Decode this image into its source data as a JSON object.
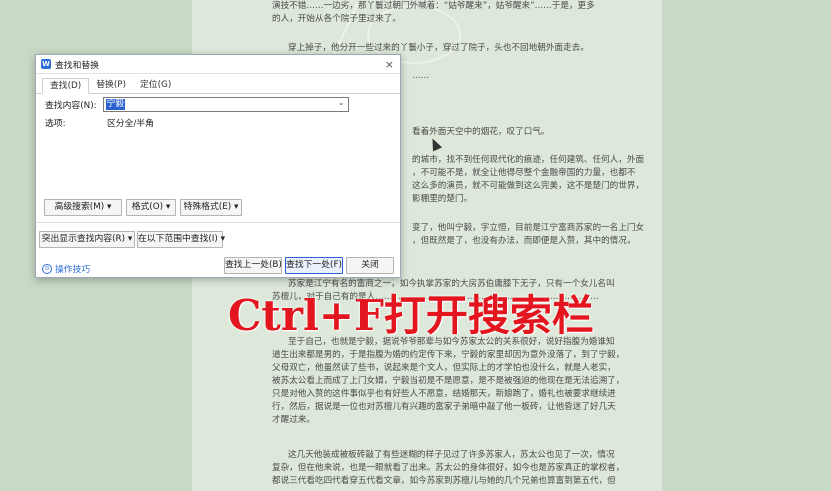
{
  "document": {
    "lines": [
      {
        "text": "演技不错……一边劣，那丫鬟过朝门外喊着：“姑爷醒来”，姑爷醒来”……于是，更多",
        "cls": "cont"
      },
      {
        "text": "的人，开始从各个院子里过来了。",
        "cls": "cont"
      },
      {
        "text": "穿上掉子，他分开一些过来的丫鬟小子，穿过了院子，头也不回地朝外面走去。",
        "cls": "indent"
      },
      {
        "text": "……",
        "cls": "partial"
      },
      {
        "text": "看着外面天空中的烟花，叹了口气。",
        "cls": "partial"
      },
      {
        "text": "的城市，找不到任何现代化的痕迹，任何建筑、任何人，外面",
        "cls": "partial"
      },
      {
        "text": "，不可能不是，就全让他得尽整个金融帝国的力量，也都不",
        "cls": "partial"
      },
      {
        "text": "这么多的演员，就不可能做到这么完美，这不是楚门的世界，",
        "cls": "partial"
      },
      {
        "text": "影棚里的楚门。",
        "cls": "partial"
      },
      {
        "text": "变了，他叫宁毅，字立恒，目前是江宁富商苏家的一名上门女",
        "cls": "partial"
      },
      {
        "text": "，但既然是了，也没有办法，而即便是入赘，其中的情况，",
        "cls": "partial"
      },
      {
        "text": "苏家是江宁有名的富商之一，如今执掌苏家的大房苏伯庸膝下无子，只有一个女儿名叫",
        "cls": "indent"
      },
      {
        "text": "苏檀儿，对于自己有的是人……………………………………………………………………",
        "cls": "cont"
      },
      {
        "text": "至于自己，也就是宁毅，据说爷爷那辈与如今苏家太公的关系很好，说好指腹为婚谁知",
        "cls": "indent"
      },
      {
        "text": "道生出来都是男的，于是指腹为婚的约定传下来，宁毅的家里却因为意外没落了，到了宁毅，",
        "cls": "cont"
      },
      {
        "text": "父母双亡，他虽然读了些书，说起来是个文人，但实际上的才学怕也没什么，就是人老实，",
        "cls": "cont"
      },
      {
        "text": "被苏太公看上而成了上门女婿，宁毅当初是不是愿意，是不是被强迫的他现在是无法追溯了，",
        "cls": "cont"
      },
      {
        "text": "只是对他入赘的这件事似乎也有好些人不愿意，结婚那天，新娘跑了，婚礼也被要求继续进",
        "cls": "cont"
      },
      {
        "text": "行，然后，据说是一位也对苏檀儿有兴趣的富家子弟暗中敲了他一板砖，让他昏迷了好几天",
        "cls": "cont"
      },
      {
        "text": "才醒过来。",
        "cls": "cont"
      },
      {
        "text": "这几天他装成被板砖敲了有些迷糊的样子见过了许多苏家人，苏太公也见了一次，情况",
        "cls": "indent"
      },
      {
        "text": "复杂，但在他来说，也是一眼就看了出来。苏太公的身体很好，如今也是苏家真正的掌权者，",
        "cls": "cont"
      },
      {
        "text": "都说三代看吃四代看穿五代看文章，如今苏家到苏檀儿与她的几个兄弟也算富到第五代，但",
        "cls": "cont"
      }
    ]
  },
  "overlay": {
    "title": "Ctrl+F打开搜索栏"
  },
  "dialog": {
    "title": "查找和替换",
    "close_label": "×",
    "tabs": [
      {
        "label": "查找(D)"
      },
      {
        "label": "替换(P)"
      },
      {
        "label": "定位(G)"
      }
    ],
    "find_label": "查找内容(N):",
    "find_value": "宁毅",
    "options_label": "选项:",
    "options_value": "区分全/半角",
    "advanced_search": "高级搜索(M) ▾",
    "format": "格式(O) ▾",
    "special_format": "特殊格式(E) ▾",
    "highlight_all": "突出显示查找内容(R) ▾",
    "find_in": "在以下范围中查找(I) ▾",
    "tips": "操作技巧",
    "find_prev": "查找上一处(B)",
    "find_next": "查找下一处(F)",
    "close_button": "关闭"
  },
  "colors": {
    "accent": "#2b62d1",
    "overlay": "#e3161f",
    "page_bg": "#dde8da"
  }
}
